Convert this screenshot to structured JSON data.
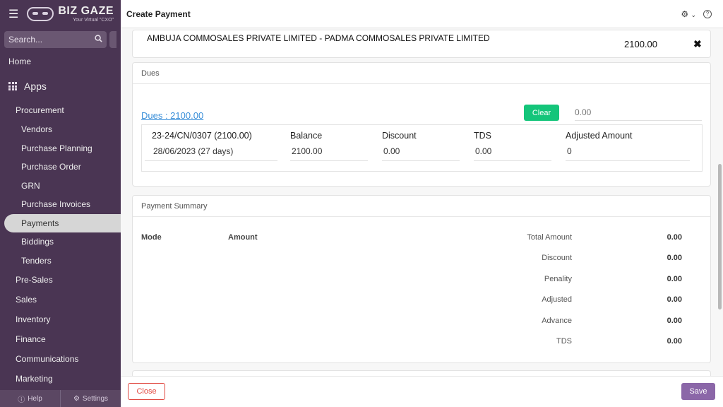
{
  "sidebar": {
    "brand_name": "BIZ GAZE",
    "brand_tagline": "Your Virtual \"CXO\"",
    "search_placeholder": "Search...",
    "home": "Home",
    "apps": "Apps",
    "procurement": "Procurement",
    "procurement_items": [
      "Vendors",
      "Purchase Planning",
      "Purchase Order",
      "GRN",
      "Purchase Invoices",
      "Payments",
      "Biddings",
      "Tenders"
    ],
    "active_item": "Payments",
    "sections": [
      "Pre-Sales",
      "Sales",
      "Inventory",
      "Finance",
      "Communications",
      "Marketing"
    ],
    "footer_help": "Help",
    "footer_settings": "Settings"
  },
  "header": {
    "title": "Create Payment"
  },
  "vendor": {
    "name": "AMBUJA COMMOSALES PRIVATE LIMITED - PADMA COMMOSALES PRIVATE LIMITED",
    "amount": "2100.00",
    "close_symbol": "✖"
  },
  "dues": {
    "header": "Dues",
    "link": "Dues : 2100.00",
    "clear_label": "Clear",
    "input_placeholder": "0.00",
    "row": {
      "ref_head": "23-24/CN/0307 (2100.00)",
      "ref_val": "28/06/2023 (27 days)",
      "balance_head": "Balance",
      "balance_val": "2100.00",
      "discount_head": "Discount",
      "discount_val": "0.00",
      "tds_head": "TDS",
      "tds_val": "0.00",
      "adjusted_head": "Adjusted Amount",
      "adjusted_val": "0"
    }
  },
  "summary": {
    "header": "Payment Summary",
    "mode_label": "Mode",
    "amount_label": "Amount",
    "rows": [
      {
        "label": "Total Amount",
        "value": "0.00"
      },
      {
        "label": "Discount",
        "value": "0.00"
      },
      {
        "label": "Penality",
        "value": "0.00"
      },
      {
        "label": "Adjusted",
        "value": "0.00"
      },
      {
        "label": "Advance",
        "value": "0.00"
      },
      {
        "label": "TDS",
        "value": "0.00"
      }
    ]
  },
  "footer": {
    "close_label": "Close",
    "save_label": "Save"
  }
}
